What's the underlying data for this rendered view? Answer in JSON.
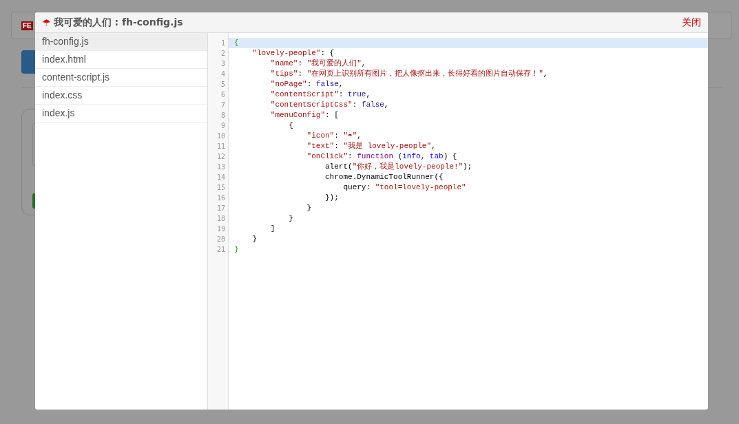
{
  "background": {
    "logo": "FE"
  },
  "dialog": {
    "title_icon": "☂",
    "title": "我可爱的人们 : fh-config.js",
    "close": "关闭"
  },
  "files": [
    {
      "name": "fh-config.js",
      "selected": true
    },
    {
      "name": "index.html",
      "selected": false
    },
    {
      "name": "content-script.js",
      "selected": false
    },
    {
      "name": "index.css",
      "selected": false
    },
    {
      "name": "index.js",
      "selected": false
    }
  ],
  "editor": {
    "lines": [
      {
        "number": "1",
        "selected": true,
        "tokens": [
          {
            "kind": "bracket",
            "text": "{"
          }
        ]
      },
      {
        "number": "2",
        "selected": false,
        "tokens": [
          {
            "kind": "string",
            "text": "    \"lovely-people\""
          },
          {
            "kind": "plain",
            "text": ": {"
          }
        ]
      },
      {
        "number": "3",
        "selected": false,
        "tokens": [
          {
            "kind": "string",
            "text": "        \"name\""
          },
          {
            "kind": "plain",
            "text": ": "
          },
          {
            "kind": "string",
            "text": "\"我可爱的人们\""
          },
          {
            "kind": "plain",
            "text": ","
          }
        ]
      },
      {
        "number": "4",
        "selected": false,
        "tokens": [
          {
            "kind": "string",
            "text": "        \"tips\""
          },
          {
            "kind": "plain",
            "text": ": "
          },
          {
            "kind": "string",
            "text": "\"在网页上识别所有图片，把人像抠出来，长得好看的图片自动保存！\""
          },
          {
            "kind": "plain",
            "text": ","
          }
        ]
      },
      {
        "number": "5",
        "selected": false,
        "tokens": [
          {
            "kind": "string",
            "text": "        \"noPage\""
          },
          {
            "kind": "plain",
            "text": ": "
          },
          {
            "kind": "atom",
            "text": "false"
          },
          {
            "kind": "plain",
            "text": ","
          }
        ]
      },
      {
        "number": "6",
        "selected": false,
        "tokens": [
          {
            "kind": "string",
            "text": "        \"contentScript\""
          },
          {
            "kind": "plain",
            "text": ": "
          },
          {
            "kind": "atom",
            "text": "true"
          },
          {
            "kind": "plain",
            "text": ","
          }
        ]
      },
      {
        "number": "7",
        "selected": false,
        "tokens": [
          {
            "kind": "string",
            "text": "        \"contentScriptCss\""
          },
          {
            "kind": "plain",
            "text": ": "
          },
          {
            "kind": "atom",
            "text": "false"
          },
          {
            "kind": "plain",
            "text": ","
          }
        ]
      },
      {
        "number": "8",
        "selected": false,
        "tokens": [
          {
            "kind": "string",
            "text": "        \"menuConfig\""
          },
          {
            "kind": "plain",
            "text": ": ["
          }
        ]
      },
      {
        "number": "9",
        "selected": false,
        "tokens": [
          {
            "kind": "plain",
            "text": "            {"
          }
        ]
      },
      {
        "number": "10",
        "selected": false,
        "tokens": [
          {
            "kind": "string",
            "text": "                \"icon\""
          },
          {
            "kind": "plain",
            "text": ": "
          },
          {
            "kind": "string",
            "text": "\"☂\""
          },
          {
            "kind": "plain",
            "text": ","
          }
        ]
      },
      {
        "number": "11",
        "selected": false,
        "tokens": [
          {
            "kind": "string",
            "text": "                \"text\""
          },
          {
            "kind": "plain",
            "text": ": "
          },
          {
            "kind": "string",
            "text": "\"我是 lovely-people\""
          },
          {
            "kind": "plain",
            "text": ","
          }
        ]
      },
      {
        "number": "12",
        "selected": false,
        "tokens": [
          {
            "kind": "string",
            "text": "                \"onClick\""
          },
          {
            "kind": "plain",
            "text": ": "
          },
          {
            "kind": "keyword",
            "text": "function"
          },
          {
            "kind": "plain",
            "text": " ("
          },
          {
            "kind": "variable",
            "text": "info"
          },
          {
            "kind": "plain",
            "text": ", "
          },
          {
            "kind": "variable",
            "text": "tab"
          },
          {
            "kind": "plain",
            "text": ") {"
          }
        ]
      },
      {
        "number": "13",
        "selected": false,
        "tokens": [
          {
            "kind": "plain",
            "text": "                    alert("
          },
          {
            "kind": "string",
            "text": "\"你好，我是lovely-people!\""
          },
          {
            "kind": "plain",
            "text": ");"
          }
        ]
      },
      {
        "number": "14",
        "selected": false,
        "tokens": [
          {
            "kind": "plain",
            "text": "                    chrome.DynamicToolRunner({"
          }
        ]
      },
      {
        "number": "15",
        "selected": false,
        "tokens": [
          {
            "kind": "plain",
            "text": "                        query: "
          },
          {
            "kind": "string",
            "text": "\"tool=lovely-people\""
          }
        ]
      },
      {
        "number": "16",
        "selected": false,
        "tokens": [
          {
            "kind": "plain",
            "text": "                    });"
          }
        ]
      },
      {
        "number": "17",
        "selected": false,
        "tokens": [
          {
            "kind": "plain",
            "text": "                }"
          }
        ]
      },
      {
        "number": "18",
        "selected": false,
        "tokens": [
          {
            "kind": "plain",
            "text": "            }"
          }
        ]
      },
      {
        "number": "19",
        "selected": false,
        "tokens": [
          {
            "kind": "plain",
            "text": "        ]"
          }
        ]
      },
      {
        "number": "20",
        "selected": false,
        "tokens": [
          {
            "kind": "plain",
            "text": "    }"
          }
        ]
      },
      {
        "number": "21",
        "selected": false,
        "tokens": [
          {
            "kind": "bracket",
            "text": "}"
          }
        ]
      }
    ]
  }
}
